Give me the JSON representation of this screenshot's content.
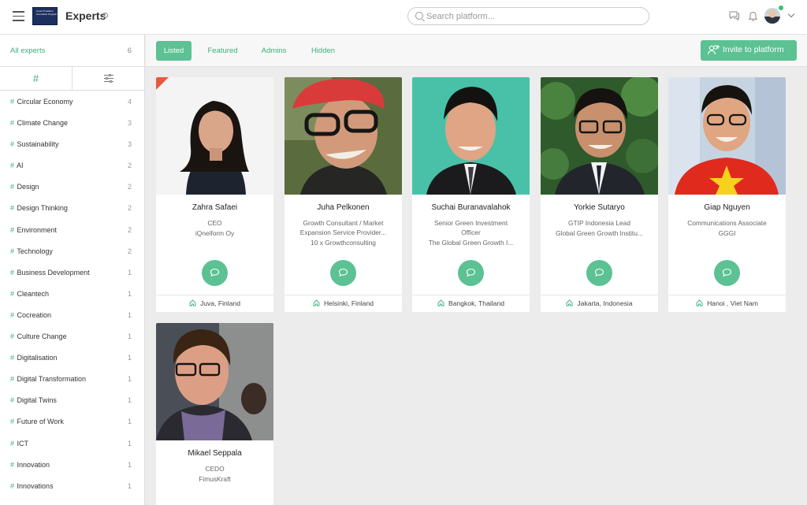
{
  "header": {
    "app_title": "Experts",
    "logo_text": "Green Transition Investment Program",
    "search_placeholder": "Search platform..."
  },
  "sidebar": {
    "all_label": "All experts",
    "all_count": "6",
    "tags": [
      {
        "name": "Circular Economy",
        "count": "4"
      },
      {
        "name": "Climate Change",
        "count": "3"
      },
      {
        "name": "Sustainability",
        "count": "3"
      },
      {
        "name": "AI",
        "count": "2"
      },
      {
        "name": "Design",
        "count": "2"
      },
      {
        "name": "Design Thinking",
        "count": "2"
      },
      {
        "name": "Environment",
        "count": "2"
      },
      {
        "name": "Technology",
        "count": "2"
      },
      {
        "name": "Business Development",
        "count": "1"
      },
      {
        "name": "Cleantech",
        "count": "1"
      },
      {
        "name": "Cocreation",
        "count": "1"
      },
      {
        "name": "Culture Change",
        "count": "1"
      },
      {
        "name": "Digitalisation",
        "count": "1"
      },
      {
        "name": "Digital Transformation",
        "count": "1"
      },
      {
        "name": "Digital Twins",
        "count": "1"
      },
      {
        "name": "Future of Work",
        "count": "1"
      },
      {
        "name": "ICT",
        "count": "1"
      },
      {
        "name": "Innovation",
        "count": "1"
      },
      {
        "name": "Innovations",
        "count": "1"
      }
    ]
  },
  "filters": {
    "tabs": [
      "Listed",
      "Featured",
      "Admins",
      "Hidden"
    ],
    "active": "Listed",
    "invite_label": "Invite to platform"
  },
  "experts": [
    {
      "name": "Zahra Safaei",
      "lines": [
        "CEO",
        "iQneiform Oy"
      ],
      "location": "Juva, Finland",
      "featured": true
    },
    {
      "name": "Juha Pelkonen",
      "lines": [
        "Growth Consultant / Market",
        "Expansion Service Provider...",
        "10 x Growthconsulting"
      ],
      "location": "Helsinki, Finland"
    },
    {
      "name": "Suchai Buranavalahok",
      "lines": [
        "Senior Green Investment",
        "Officer",
        "The Global Green Growth I..."
      ],
      "location": "Bangkok, Thailand"
    },
    {
      "name": "Yorkie Sutaryo",
      "lines": [
        "GTIP Indonesia Lead",
        "Global Green Growth Institu..."
      ],
      "location": "Jakarta, Indonesia"
    },
    {
      "name": "Giap Nguyen",
      "lines": [
        "Communications Associate",
        "GGGI"
      ],
      "location": "Hanoi , Viet Nam"
    },
    {
      "name": "Mikael Seppala",
      "lines": [
        "CEDO",
        "FimusKraft"
      ],
      "location": ""
    }
  ],
  "colors": {
    "accent": "#5cc193",
    "featured": "#e75a3e"
  }
}
